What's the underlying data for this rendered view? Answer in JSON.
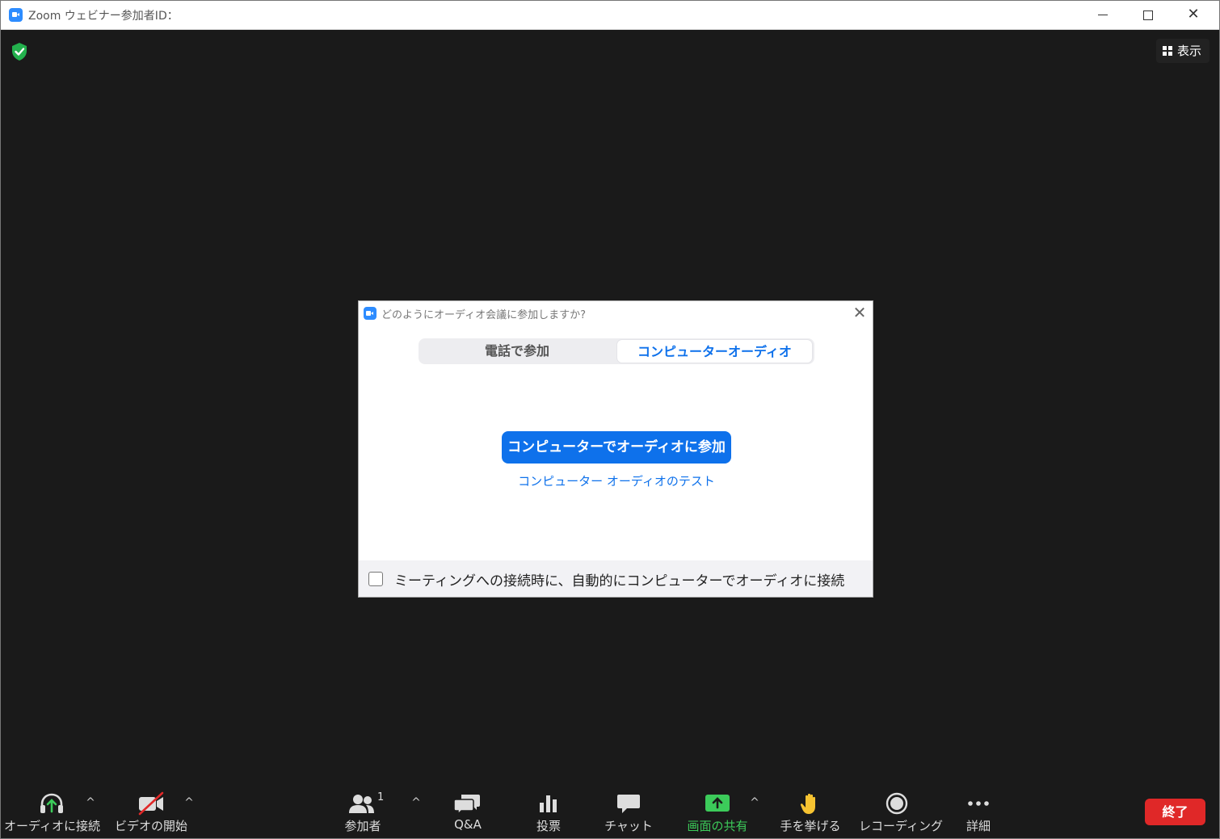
{
  "window": {
    "title": "Zoom ウェビナー参加者ID：",
    "controls": [
      "minimize",
      "maximize",
      "close"
    ]
  },
  "stage": {
    "view_button_label": "表示",
    "icons": [
      "shield-check-icon",
      "grid-icon"
    ]
  },
  "dialog": {
    "title": "どのようにオーディオ会議に参加しますか?",
    "tabs": [
      {
        "label": "電話で参加",
        "selected": false
      },
      {
        "label": "コンピューターオーディオ",
        "selected": true
      }
    ],
    "primary_button": "コンピューターでオーディオに参加",
    "test_link": "コンピューター オーディオのテスト",
    "auto_connect_label": "ミーティングへの接続時に、自動的にコンピューターでオーディオに接続",
    "auto_connect_checked": false
  },
  "toolbar": {
    "audio": "オーディオに接続",
    "video": "ビデオの開始",
    "participants": "参加者",
    "participants_count": "1",
    "qa": "Q&A",
    "poll": "投票",
    "chat": "チャット",
    "share": "画面の共有",
    "raise_hand": "手を挙げる",
    "recording": "レコーディング",
    "more": "詳細",
    "end": "終了"
  },
  "colors": {
    "accent": "#0e71eb",
    "zoom_blue": "#2d8cff",
    "share_green": "#3ccb5a",
    "end_red": "#e02828",
    "background": "#1a1a1a"
  }
}
